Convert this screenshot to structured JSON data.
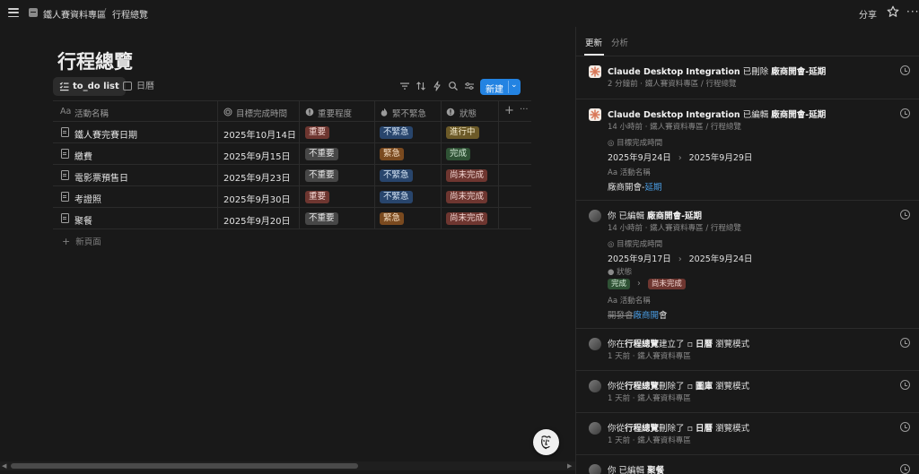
{
  "breadcrumb": {
    "workspace": "鐵人賽資料專區",
    "separator": "/",
    "page": "行程總覽"
  },
  "topbar": {
    "share": "分享",
    "more": "···"
  },
  "page": {
    "title": "行程總覽"
  },
  "views": {
    "active": "to_do list",
    "calendar": "日曆"
  },
  "toolbar": {
    "new_label": "新建",
    "new_chevron": "⌄"
  },
  "table": {
    "headers": {
      "name": "活動名稱",
      "date": "目標完成時間",
      "importance": "重要程度",
      "urgency": "緊不緊急",
      "status": "狀態",
      "name_prefix": "Aa"
    },
    "rows": [
      {
        "name": "鐵人賽完賽日期",
        "date": "2025年10月14日",
        "importance": "重要",
        "urgency": "不緊急",
        "status": "進行中"
      },
      {
        "name": "繳費",
        "date": "2025年9月15日",
        "importance": "不重要",
        "urgency": "緊急",
        "status": "完成"
      },
      {
        "name": "電影票預售日",
        "date": "2025年9月23日",
        "importance": "不重要",
        "urgency": "不緊急",
        "status": "尚未完成"
      },
      {
        "name": "考證照",
        "date": "2025年9月30日",
        "importance": "重要",
        "urgency": "不緊急",
        "status": "尚未完成"
      },
      {
        "name": "聚餐",
        "date": "2025年9月20日",
        "importance": "不重要",
        "urgency": "緊急",
        "status": "尚未完成"
      }
    ],
    "add_row": "新頁面"
  },
  "colors": {
    "accent": "#2383e2",
    "red": "#6e3630",
    "gray": "#474747",
    "blue": "#28456c",
    "orange": "#7a4a1f",
    "yellow": "#6c5a28",
    "green": "#2f5235"
  },
  "panel": {
    "tabs": {
      "updates": "更新",
      "analytics": "分析"
    },
    "entries": {
      "e1": {
        "actor": "Claude Desktop Integration",
        "action": "已刪除",
        "target": "廠商開會-延期",
        "sub": "2 分鐘前 · 鐵人賽資料專區 / 行程總覽"
      },
      "e2": {
        "actor": "Claude Desktop Integration",
        "action": "已編輯",
        "target": "廠商開會-延期",
        "sub": "14 小時前 · 鐵人賽資料專區 / 行程總覽",
        "prop1": "目標完成時間",
        "from1": "2025年9月24日",
        "to1": "2025年9月29日",
        "prop2": "活動名稱",
        "name_plain": "廠商開會-",
        "name_added": "延期"
      },
      "e3": {
        "actor": "你",
        "action": "已編輯",
        "target": "廠商開會-延期",
        "sub": "14 小時前 · 鐵人賽資料專區 / 行程總覽",
        "prop1": "目標完成時間",
        "from1": "2025年9月17日",
        "to1": "2025年9月24日",
        "prop2": "狀態",
        "from2": "完成",
        "to2": "尚未完成",
        "prop3": "活動名稱",
        "name_removed": "開發會",
        "name_added": "廠商開",
        "name_plain": "會"
      },
      "e4": {
        "pre": "你在",
        "page": "行程總覽",
        "action": "建立了",
        "view": "日曆",
        "suffix": "瀏覽模式",
        "sub": "1 天前 · 鐵人賽資料專區"
      },
      "e5": {
        "pre": "你從",
        "page": "行程總覽",
        "action": "刪除了",
        "view": "圖庫",
        "suffix": "瀏覽模式",
        "sub": "1 天前 · 鐵人賽資料專區"
      },
      "e6": {
        "pre": "你從",
        "page": "行程總覽",
        "action": "刪除了",
        "view": "日曆",
        "suffix": "瀏覽模式",
        "sub": "1 天前 · 鐵人賽資料專區"
      },
      "e7": {
        "actor": "你",
        "action": "已編輯",
        "target": "聚餐"
      }
    }
  }
}
